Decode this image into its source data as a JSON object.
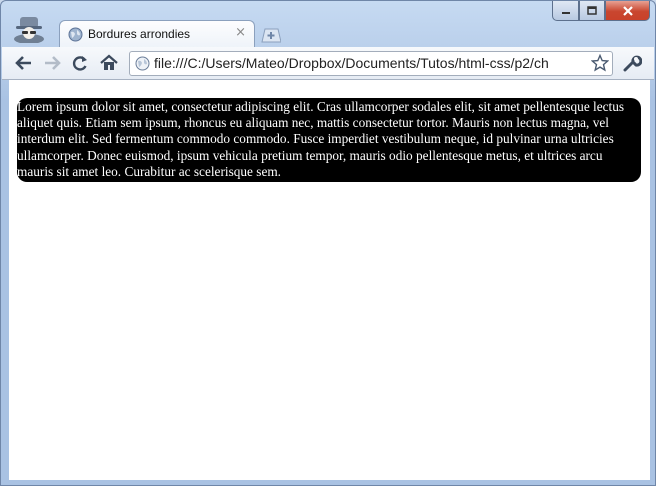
{
  "window": {
    "tab_title": "Bordures arrondies",
    "tab_close_glyph": "×"
  },
  "toolbar": {
    "url": "file:///C:/Users/Mateo/Dropbox/Documents/Tutos/html-css/p2/ch"
  },
  "page": {
    "paragraph": "Lorem ipsum dolor sit amet, consectetur adipiscing elit. Cras ullamcorper sodales elit, sit amet pellentesque lectus aliquet quis. Etiam sem ipsum, rhoncus eu aliquam nec, mattis consectetur tortor. Mauris non lectus magna, vel interdum elit. Sed fermentum commodo commodo. Fusce imperdiet vestibulum neque, id pulvinar urna ultricies ullamcorper. Donec euismod, ipsum vehicula pretium tempor, mauris odio pellentesque metus, et ultrices arcu mauris sit amet leo. Curabitur ac scelerisque sem."
  },
  "icons": {
    "incognito": "incognito-icon",
    "tab_favicon": "globe-icon",
    "new_tab": "new-tab-icon",
    "back": "back-arrow-icon",
    "forward": "forward-arrow-icon",
    "reload": "reload-icon",
    "home": "home-icon",
    "page": "page-info-icon",
    "bookmark": "star-icon",
    "menu": "wrench-icon",
    "minimize": "minimize-icon",
    "maximize": "maximize-icon",
    "close": "close-icon"
  },
  "colors": {
    "block_background": "#000000",
    "block_text": "#ffffff",
    "frame": "#b7cde9",
    "close_button": "#c9462f"
  }
}
